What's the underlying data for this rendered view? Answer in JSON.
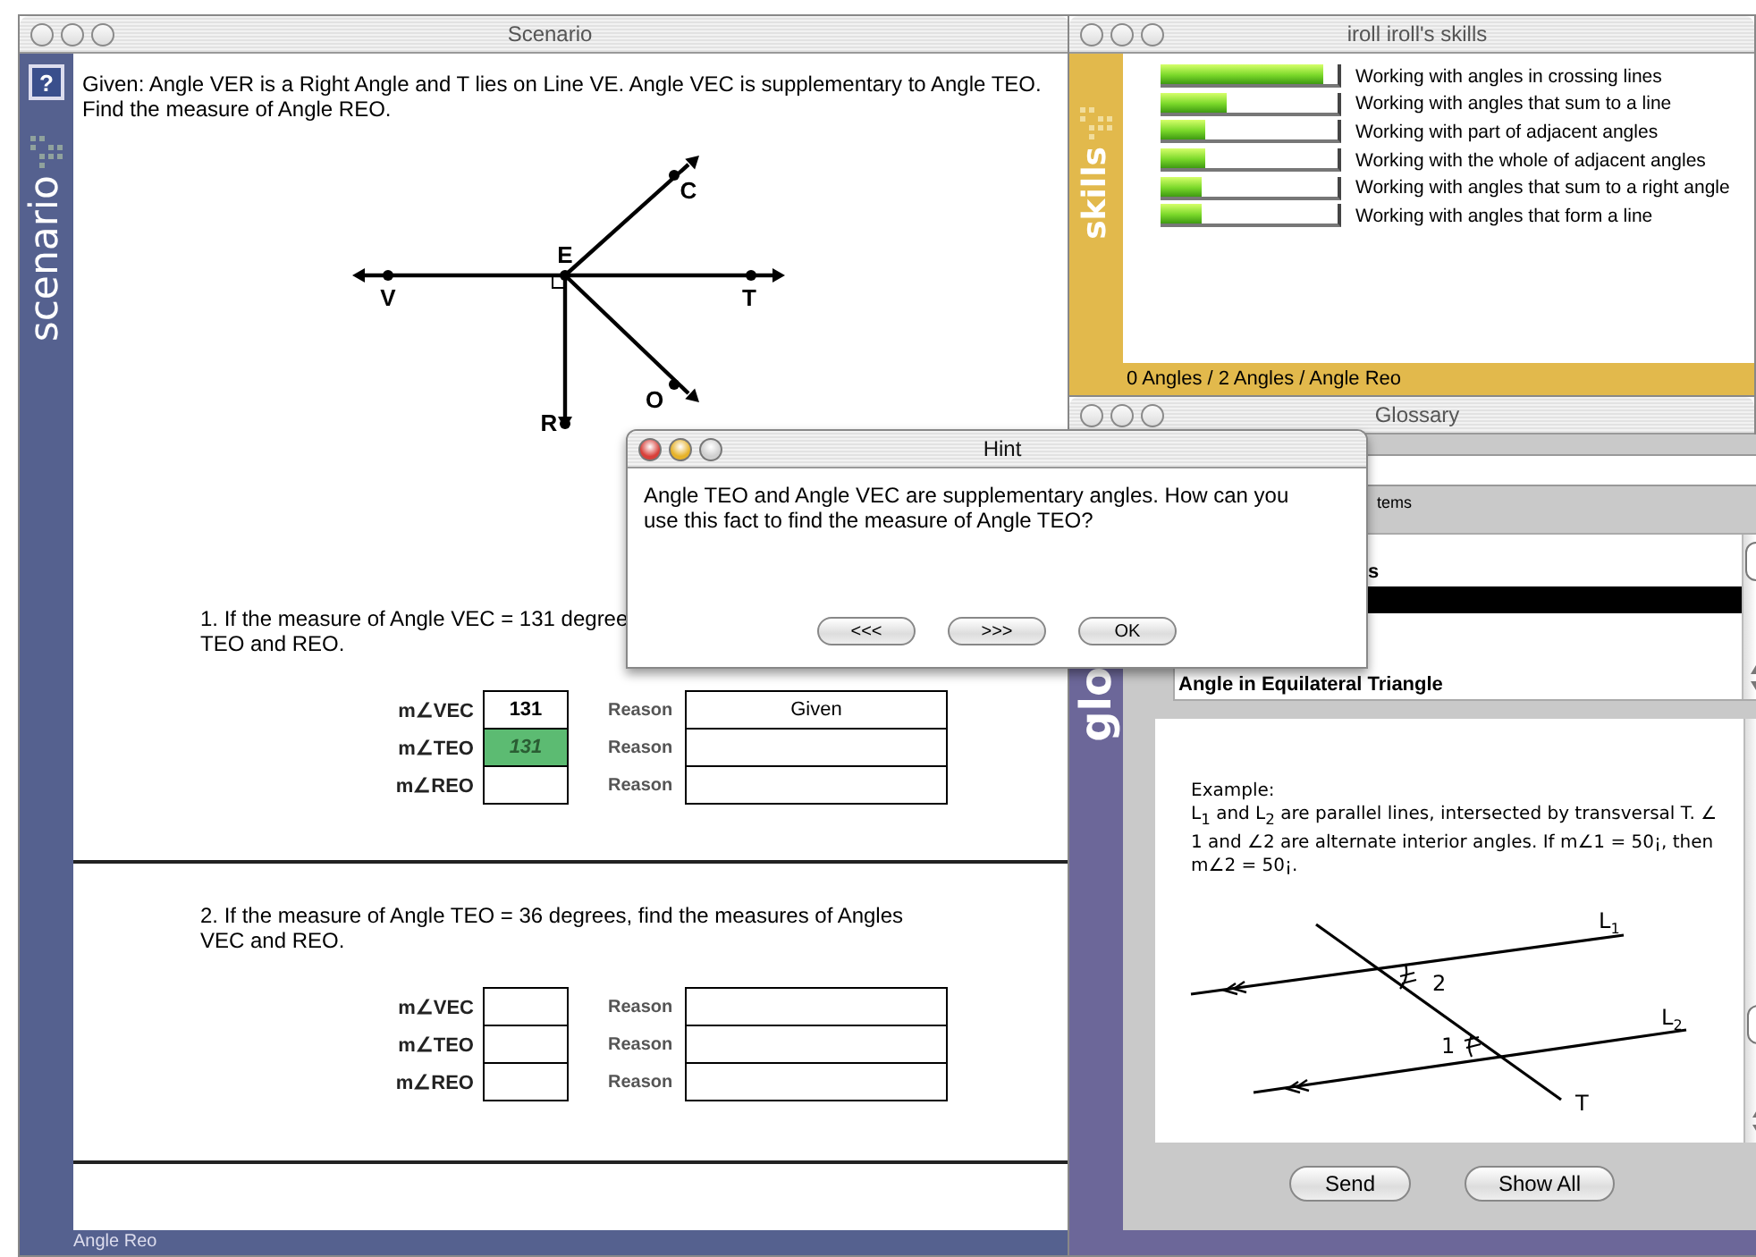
{
  "scenario_window": {
    "title": "Scenario",
    "active": false,
    "help_button": "?",
    "sidebar_label": "scenario",
    "given": "Given: Angle VER is a Right Angle and T lies on Line VE. Angle VEC is supplementary to Angle TEO. Find the measure of Angle REO.",
    "diagram_labels": [
      "C",
      "E",
      "V",
      "T",
      "O",
      "R"
    ],
    "problems": [
      {
        "prompt_lines": [
          "1. If the measure of Angle VEC = 131 degree",
          "TEO and REO."
        ],
        "rows": [
          {
            "label": "m∠VEC",
            "value": "131",
            "highlighted": false,
            "reason_label": "Reason",
            "reason": "Given"
          },
          {
            "label": "m∠TEO",
            "value": "131",
            "highlighted": true,
            "reason_label": "Reason"
          },
          {
            "label": "m∠REO",
            "highlighted": false,
            "reason_label": "Reason"
          }
        ]
      },
      {
        "prompt_lines": [
          "2. If the measure of Angle TEO = 36 degrees, find the measures of Angles",
          "VEC and REO."
        ],
        "rows": [
          {
            "label": "m∠VEC",
            "highlighted": false,
            "reason_label": "Reason"
          },
          {
            "label": "m∠TEO",
            "highlighted": false,
            "reason_label": "Reason"
          },
          {
            "label": "m∠REO",
            "highlighted": false,
            "reason_label": "Reason"
          }
        ]
      }
    ],
    "status_bar": "Angle Reo"
  },
  "skills_window": {
    "title": "iroll iroll's skills",
    "active": false,
    "sidebar_label": "skills",
    "skills": [
      {
        "name": "Working with angles in crossing lines",
        "level": 0.92
      },
      {
        "name": "Working with angles that sum to a line",
        "level": 0.37
      },
      {
        "name": "Working with part of adjacent angles",
        "level": 0.25
      },
      {
        "name": "Working with the whole of adjacent angles",
        "level": 0.25
      },
      {
        "name": "Working with angles that sum to a right angle",
        "level": 0.23
      },
      {
        "name": "Working with angles that form a line",
        "level": 0.23
      }
    ],
    "breadcrumb": "0 Angles / 2 Angles / Angle Reo"
  },
  "glossary_window": {
    "title": "Glossary",
    "active": false,
    "sidebar_label": "glo",
    "items_caption": "tems",
    "list": [
      {
        "label": "s",
        "selected": false
      },
      {
        "selected": true
      },
      {
        "label": "Angle in Equilateral Triangle",
        "selected": false
      }
    ],
    "example": {
      "heading": "Example:",
      "text": "L$_{1}$ and L$_{2}$ are parallel lines, intersected by transversal T. ∠ 1 and ∠2 are alternate interior angles. If m∠1 = 50¡, then m∠2 = 50¡.",
      "figure_labels": [
        {
          "text": "L",
          "subscript": "1"
        },
        {
          "text": "L",
          "subscript": "2"
        },
        {
          "text": "T"
        },
        {
          "text": "2"
        },
        {
          "text": "1"
        }
      ]
    },
    "buttons": [
      "Send",
      "Show All"
    ]
  },
  "hint_dialog": {
    "title": "Hint",
    "active": true,
    "message": "Angle TEO and Angle VEC are supplementary angles. How can you use this fact to find the measure of Angle TEO?",
    "buttons": [
      "<<<",
      ">>>",
      "OK"
    ]
  }
}
